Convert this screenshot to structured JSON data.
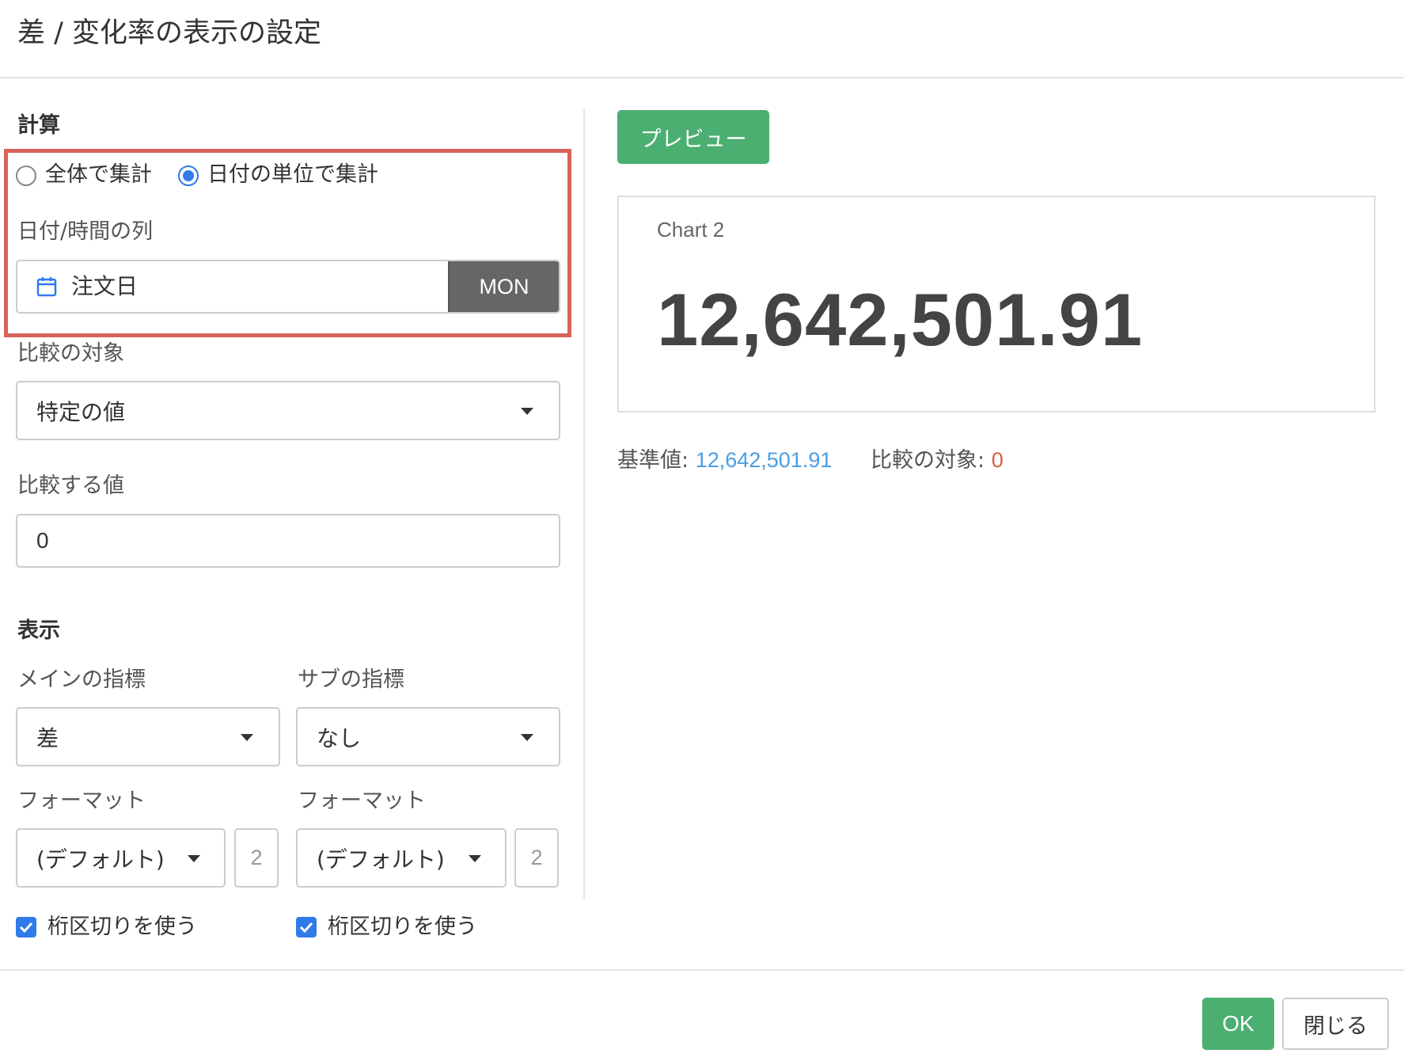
{
  "dialog": {
    "title": "差 / 変化率の表示の設定"
  },
  "calculation": {
    "section_title": "計算",
    "radio_all": "全体で集計",
    "radio_by_date": "日付の単位で集計",
    "selected": "by_date",
    "date_column_label": "日付/時間の列",
    "date_column_value": "注文日",
    "date_unit": "MON",
    "compare_target_label": "比較の対象",
    "compare_target_value": "特定の値",
    "compare_value_label": "比較する値",
    "compare_value": "0"
  },
  "display": {
    "section_title": "表示",
    "main_metric_label": "メインの指標",
    "main_metric_value": "差",
    "sub_metric_label": "サブの指標",
    "sub_metric_value": "なし",
    "main_format_label": "フォーマット",
    "main_format_value": "(デフォルト)",
    "main_digits": "2",
    "sub_format_label": "フォーマット",
    "sub_format_value": "(デフォルト)",
    "sub_digits": "2",
    "main_separator_label": "桁区切りを使う",
    "sub_separator_label": "桁区切りを使う",
    "main_separator_checked": true,
    "sub_separator_checked": true
  },
  "preview": {
    "button_label": "プレビュー",
    "chart_title": "Chart 2",
    "chart_value": "12,642,501.91",
    "base_label": "基準値: ",
    "base_value": "12,642,501.91",
    "compare_label": "比較の対象: ",
    "compare_value": "0"
  },
  "footer": {
    "ok_label": "OK",
    "close_label": "閉じる"
  },
  "colors": {
    "accent_green": "#4caf72",
    "checkbox_blue": "#2f7bea",
    "highlight_red": "#d9625b",
    "value_blue": "#4a9ee3",
    "value_red": "#e05a47"
  }
}
